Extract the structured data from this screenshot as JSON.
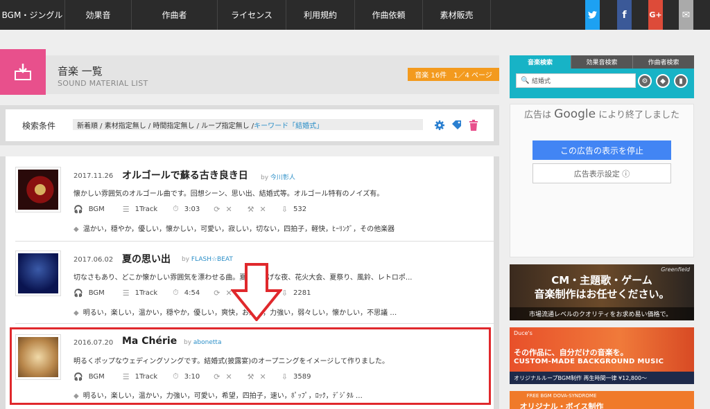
{
  "nav": {
    "items": [
      "BGM・ジングル",
      "効果音",
      "作曲者",
      "ライセンス",
      "利用規約",
      "作曲依頼",
      "素材販売"
    ]
  },
  "social": [
    {
      "name": "twitter-icon",
      "glyph": "🐦",
      "color": "#1da1f2"
    },
    {
      "name": "facebook-icon",
      "glyph": "f",
      "color": "#3b5998"
    },
    {
      "name": "google-plus-icon",
      "glyph": "G+",
      "color": "#dd4b39"
    },
    {
      "name": "mail-icon",
      "glyph": "✉",
      "color": "#aaaaaa"
    }
  ],
  "header": {
    "title": "音楽 一覧",
    "subtitle": "SOUND MATERIAL LIST",
    "count_badge": "音楽 16件　1／4 ページ"
  },
  "search_condition": {
    "label": "検索条件",
    "conditions": "新着順 / 素材指定無し / 時間指定無し / ループ指定無し / ",
    "keyword": "キーワード「結婚式」"
  },
  "items": [
    {
      "date": "2017.11.26",
      "title": "オルゴールで蘇る古き良き日",
      "by": "by",
      "author": "今川彰人",
      "desc": "懐かしい雰囲気のオルゴール曲です。回想シーン、思い出、結婚式等。オルゴール特有のノイズ有。",
      "genre": "BGM",
      "tracks": "1Track",
      "length": "3:03",
      "downloads": "532",
      "tags": "温かい，穏やか，優しい，懐かしい，可愛い，寂しい，切ない，四拍子，軽快，ﾋｰﾘﾝｸﾞ，その他楽器"
    },
    {
      "date": "2017.06.02",
      "title": "夏の思い出",
      "by": "by",
      "author": "FLASH☆BEAT",
      "desc": "切なさもあり、どこか懐かしい雰囲気を漂わせる曲。夏の涼しげな夜、花火大会、夏祭り、風鈴、レトロポ...",
      "genre": "BGM",
      "tracks": "1Track",
      "length": "4:54",
      "downloads": "2281",
      "tags": "明るい，楽しい，温かい，穏やか，優しい，爽快，お洒落，力強い，弱々しい，懐かしい，不思議 …"
    },
    {
      "date": "2016.07.20",
      "title": "Ma Chérie",
      "by": "by",
      "author": "abonetta",
      "desc": "明るくポップなウェディングソングです。結婚式(披露宴)のオープニングをイメージして作りました。",
      "genre": "BGM",
      "tracks": "1Track",
      "length": "3:10",
      "downloads": "3589",
      "tags": "明るい，楽しい，温かい，力強い，可愛い，希望，四拍子，速い，ﾎﾟｯﾌﾟ，ﾛｯｸ，ﾃﾞｼﾞﾀﾙ …"
    }
  ],
  "sidebar": {
    "tabs": [
      "音楽検索",
      "効果音検索",
      "作曲者検索"
    ],
    "search_value": "結婚式",
    "ad": {
      "text_pre": "広告は ",
      "text_brand": "Google",
      "text_post": " により終了しました",
      "stop_button": "この広告の表示を停止",
      "settings_button": "広告表示設定 ⓘ"
    },
    "banner1": {
      "line1": "CM・主題歌・ゲーム",
      "line2": "音楽制作はお任せください。",
      "line3": "市場流通レベルのクオリティをお求め易い価格で。",
      "brand": "Greenfield"
    },
    "banner2": {
      "line1": "その作品に、自分だけの音楽を。",
      "line2": "CUSTOM-MADE BACKGROUND MUSIC",
      "line3": "オリジナルループBGM制作 再生時間一律 ¥12,800～",
      "brand": "Duce's"
    },
    "banner3": {
      "line1": "FREE BGM DOVA-SYNDROME",
      "line2": "オリジナル・ボイス制作"
    }
  },
  "colors": {
    "accent": "#17b3c6",
    "pink": "#e8508c",
    "orange": "#f39a1e",
    "highlight": "#e0282c",
    "link": "#2a8ec7"
  }
}
